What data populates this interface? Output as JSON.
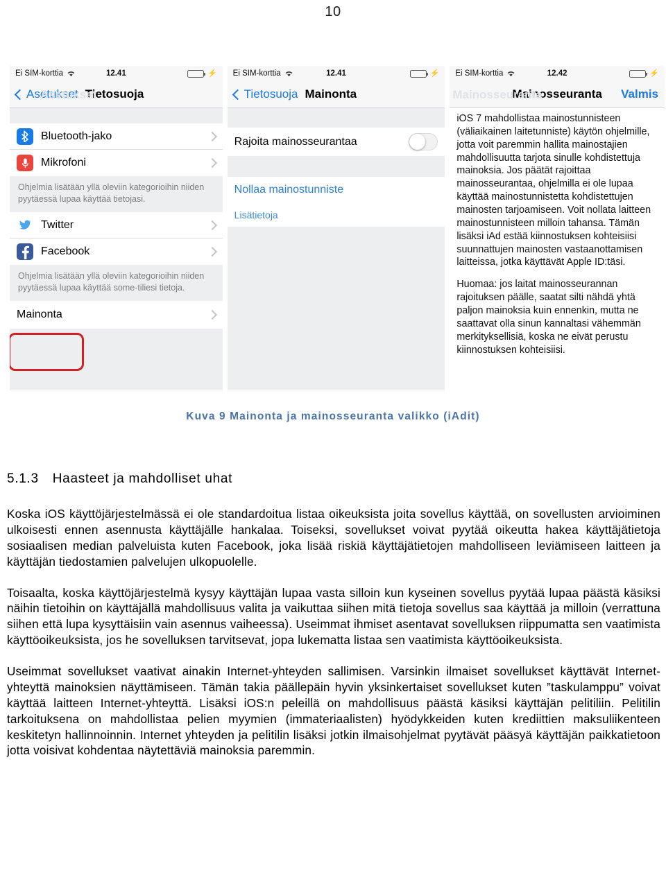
{
  "page": {
    "number": "10"
  },
  "figure": {
    "caption": "Kuva 9 Mainonta ja mainosseuranta valikko (iAdit)",
    "screens": [
      {
        "statusbar": {
          "carrier": "Ei SIM-korttia",
          "time": "12.41",
          "wifi_icon": "wifi-icon",
          "battery_icon": "battery-icon",
          "charging_icon": "bolt-icon"
        },
        "nav": {
          "back_label": "Asetukset",
          "title": "Tietosuoja",
          "ghost": "Asetukset"
        },
        "rows": [
          {
            "label": "Bluetooth-jako",
            "icon": "bluetooth-icon",
            "chevron": "chevron-right-icon"
          },
          {
            "label": "Mikrofoni",
            "icon": "microphone-icon",
            "chevron": "chevron-right-icon"
          }
        ],
        "note1": "Ohjelmia lisätään yllä oleviin kategorioihin niiden pyytäessä lupaa käyttää tietojasi.",
        "social": [
          {
            "label": "Twitter",
            "icon": "twitter-icon",
            "chevron": "chevron-right-icon"
          },
          {
            "label": "Facebook",
            "icon": "facebook-icon",
            "chevron": "chevron-right-icon"
          }
        ],
        "note2": "Ohjelmia lisätään yllä oleviin kategorioihin niiden pyytäessä lupaa käyttää some-tiliesi tietoja.",
        "highlighted_row": {
          "label": "Mainonta",
          "chevron": "chevron-right-icon",
          "highlight_color": "#cf2026"
        }
      },
      {
        "statusbar": {
          "carrier": "Ei SIM-korttia",
          "time": "12.41"
        },
        "nav": {
          "back_label": "Tietosuoja",
          "title": "Mainonta"
        },
        "toggle_row": {
          "label": "Rajoita mainosseurantaa",
          "state": "off"
        },
        "links": [
          {
            "label": "Nollaa mainostunniste"
          },
          {
            "label": "Lisätietoja"
          }
        ]
      },
      {
        "statusbar": {
          "carrier": "Ei SIM-korttia",
          "time": "12.42"
        },
        "nav": {
          "title": "Mainosseuranta",
          "action_label": "Valmis",
          "ghost": "Mainosseuranta"
        },
        "paragraphs": [
          "iOS 7 mahdollistaa mainostunnisteen (väliaikainen laitetunniste) käytön ohjelmille, jotta voit paremmin hallita mainostajien mahdollisuutta tarjota sinulle kohdistettuja mainoksia. Jos päätät rajoittaa mainosseurantaa, ohjelmilla ei ole lupaa käyttää mainostunnistetta kohdistettujen mainosten tarjoamiseen. Voit nollata laitteen mainostunnisteen milloin tahansa. Tämän lisäksi iAd estää kiinnostuksen kohteisiisi suunnattujen mainosten vastaanottamisen laitteissa, jotka käyttävät Apple ID:täsi.",
          "Huomaa: jos laitat mainosseurannan rajoituksen päälle, saatat silti nähdä yhtä paljon mainoksia kuin ennenkin, mutta ne saattavat olla sinun kannaltasi vähemmän merkityksellisiä, koska ne eivät perustu kiinnostuksen kohteisiisi."
        ]
      }
    ]
  },
  "document": {
    "heading_number": "5.1.3",
    "heading_text": "Haasteet ja mahdolliset uhat",
    "paragraphs": [
      "Koska iOS käyttöjärjestelmässä ei ole standardoitua listaa oikeuksista joita sovellus käyttää, on sovellusten arvioiminen ulkoisesti ennen asennusta käyttäjälle hankalaa. Toiseksi, sovellukset voivat pyytää oikeutta hakea käyttäjätietoja sosiaalisen median palveluista kuten Facebook, joka lisää riskiä käyttäjätietojen mahdolliseen leviämiseen laitteen ja käyttäjän tiedostamien palvelujen ulkopuolelle.",
      "Toisaalta, koska käyttöjärjestelmä kysyy käyttäjän lupaa vasta silloin kun kyseinen sovellus pyytää lupaa päästä käsiksi näihin tietoihin on käyttäjällä mahdollisuus valita ja vaikuttaa siihen mitä tietoja sovellus saa käyttää ja milloin (verrattuna siihen että lupa kysyttäisiin vain asennus vaiheessa). Useimmat ihmiset asentavat sovelluksen riippumatta sen vaatimista käyttöoikeuksista, jos he sovelluksen tarvitsevat, jopa lukematta listaa sen vaatimista käyttöoikeuksista.",
      "Useimmat sovellukset vaativat ainakin Internet-yhteyden sallimisen. Varsinkin ilmaiset sovellukset käyttävät Internet-yhteyttä mainoksien näyttämiseen. Tämän takia päällepäin hyvin yksinkertaiset sovellukset kuten ”taskulamppu” voivat käyttää laitteen Internet-yhteyttä. Lisäksi iOS:n peleillä on mahdollisuus päästä käsiksi käyttäjän pelitiliin. Pelitilin tarkoituksena on mahdollistaa pelien myymien (immateriaalisten) hyödykkeiden kuten krediittien maksuliikenteen keskitetyn hallinnoinnin. Internet yhteyden ja pelitilin lisäksi jotkin ilmaisohjelmat pyytävät pääsyä käyttäjän paikkatietoon jotta voisivat kohdentaa näytettäviä mainoksia paremmin."
    ]
  }
}
